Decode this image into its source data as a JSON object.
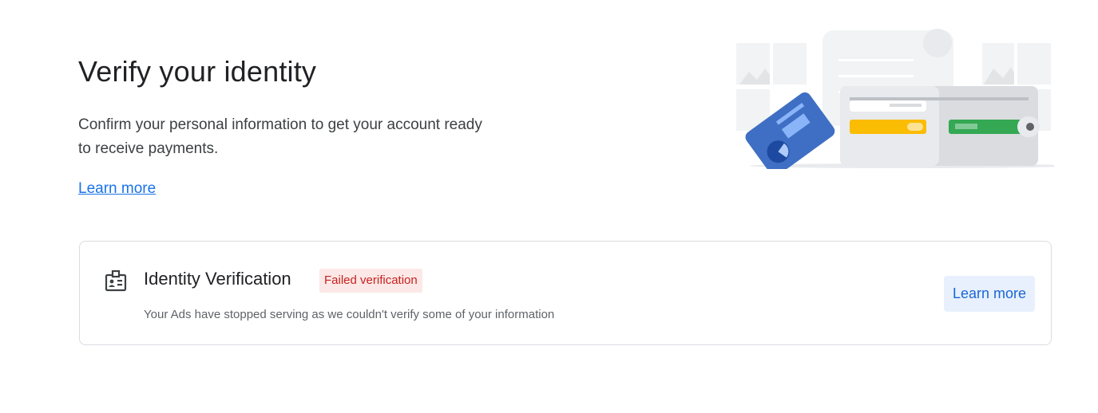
{
  "header": {
    "title": "Verify your identity",
    "subtitle": "Confirm your personal information to get your account ready to receive payments.",
    "learn_more_link": "Learn more"
  },
  "illustration": {
    "icon": "id-card-wallet-illustration",
    "colors": {
      "card_blue": "#3f6fc4",
      "card_yellow": "#fbbc04",
      "card_green": "#34a853",
      "wallet_grey": "#dadce0"
    }
  },
  "verification_card": {
    "icon": "id-badge-icon",
    "title": "Identity Verification",
    "status": "Failed verification",
    "description": "Your Ads have stopped serving as we couldn't verify some of your information",
    "button_label": "Learn more"
  },
  "colors": {
    "link": "#1a73e8",
    "error_text": "#c5221f",
    "error_bg": "#fce8e6",
    "button_bg": "#e8f0fe",
    "button_text": "#1967d2"
  }
}
